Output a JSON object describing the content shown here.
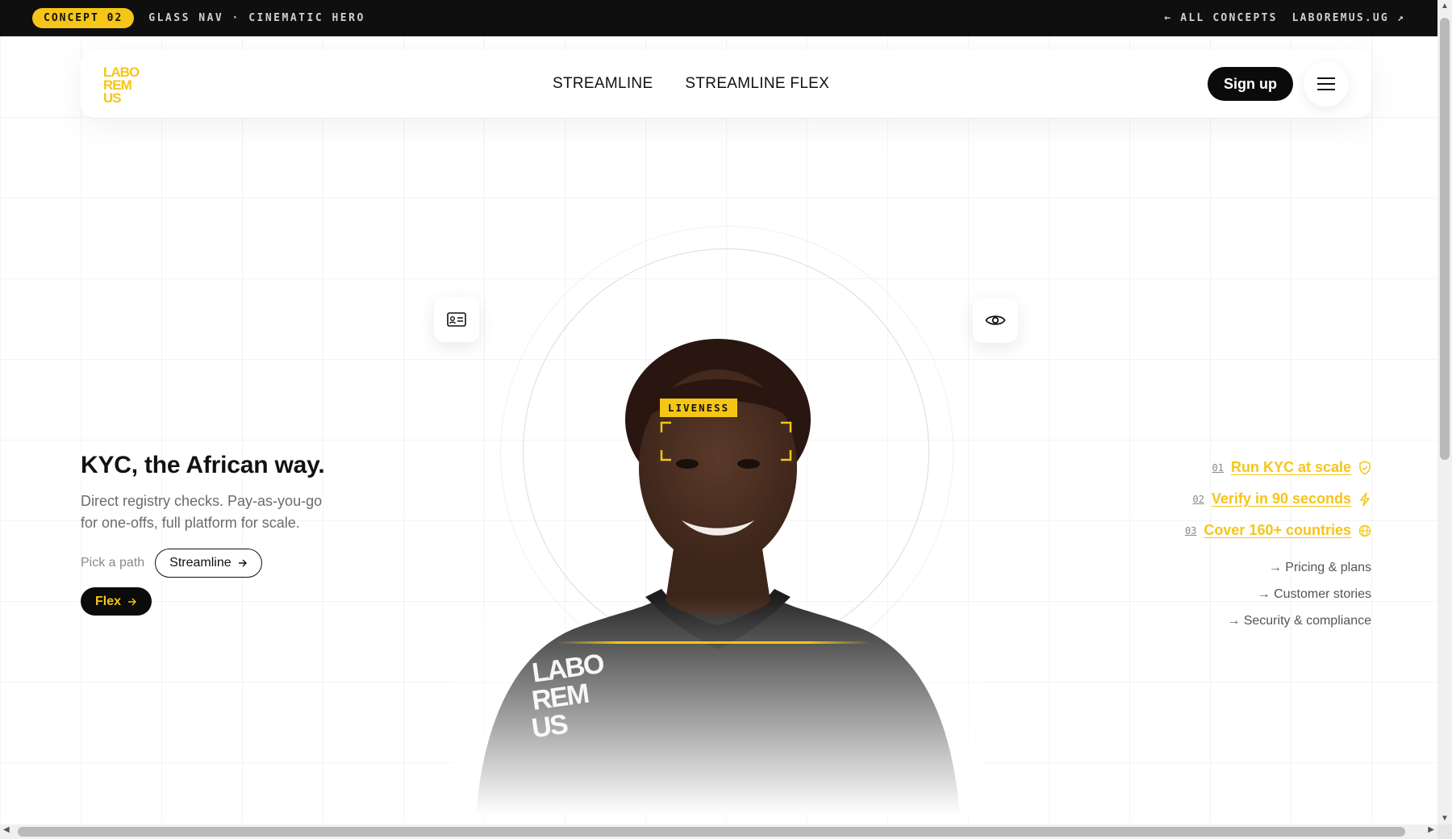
{
  "topbar": {
    "badge": "CONCEPT 02",
    "subtitle": "GLASS NAV · CINEMATIC HERO",
    "back_link": "← ALL CONCEPTS",
    "site_link": "LABOREMUS.UG ↗"
  },
  "nav": {
    "logo_alt": "LABOREMUS logo",
    "links": [
      "STREAMLINE",
      "STREAMLINE FLEX"
    ],
    "signup_label": "Sign up",
    "menu_icon": "hamburger-icon"
  },
  "hero": {
    "title": "KYC, the African way.",
    "description": "Direct registry checks. Pay-as-you-go for one-offs, full platform for scale.",
    "path_label": "Pick a path",
    "streamline_button": "Streamline",
    "flex_button": "Flex"
  },
  "portrait": {
    "liveness_tag": "LIVENESS",
    "shirt_logo": "LABOREMUS",
    "left_card_icon": "id-card-icon",
    "right_card_icon": "eye-icon"
  },
  "features": [
    {
      "num": "01",
      "label": "Run KYC at scale",
      "icon": "shield-icon"
    },
    {
      "num": "02",
      "label": "Verify in 90 seconds",
      "icon": "bolt-icon"
    },
    {
      "num": "03",
      "label": "Cover 160+ countries",
      "icon": "globe-icon"
    }
  ],
  "quick_links": [
    "→ Pricing & plans",
    "→ Customer stories",
    "→ Security & compliance"
  ],
  "colors": {
    "accent": "#f5c518",
    "dark": "#0b0b0b",
    "text_muted": "#6b6b6b"
  }
}
